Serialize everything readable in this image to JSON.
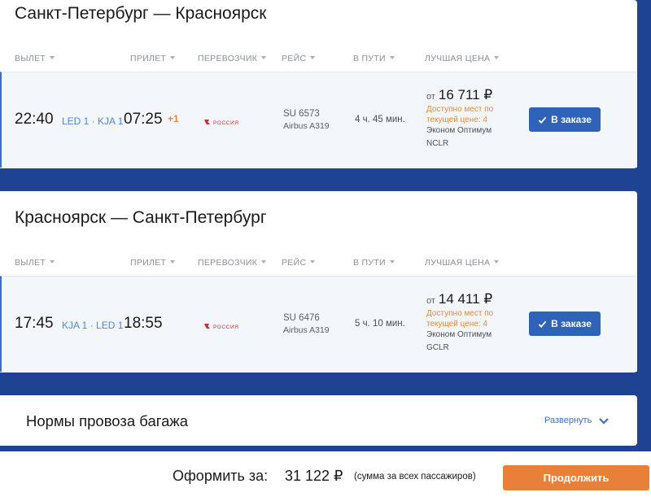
{
  "columns": {
    "depart": "ВЫЛЕТ",
    "arrive": "ПРИЛЕТ",
    "carrier": "ПЕРЕВОЗЧИК",
    "flight": "РЕЙС",
    "duration": "В ПУТИ",
    "best_price": "ЛУЧШАЯ ЦЕНА"
  },
  "segments": [
    {
      "route": "Санкт-Петербург — Красноярск",
      "depart_time": "22:40",
      "airports": "LED 1 · KJA 1",
      "arrive_time": "07:25",
      "day_offset": "+1",
      "carrier_logo_text": "РОССИЯ",
      "flight_no": "SU 6573",
      "aircraft": "Airbus A319",
      "duration": "4 ч. 45 мин.",
      "price_prefix": "от",
      "price": "16 711 ₽",
      "seats_left": "Доступно мест по текущей цене: 4",
      "fare": "Эконом Оптимум",
      "fare_code": "NCLR",
      "book_label": "В заказе"
    },
    {
      "route": "Красноярск — Санкт-Петербург",
      "depart_time": "17:45",
      "airports": "KJA 1 · LED 1",
      "arrive_time": "18:55",
      "day_offset": "",
      "carrier_logo_text": "РОССИЯ",
      "flight_no": "SU 6476",
      "aircraft": "Airbus A319",
      "duration": "5 ч. 10 мин.",
      "price_prefix": "от",
      "price": "14 411 ₽",
      "seats_left": "Доступно мест по текущей цене: 4",
      "fare": "Эконом Оптимум",
      "fare_code": "GCLR",
      "book_label": "В заказе"
    }
  ],
  "baggage": {
    "title": "Нормы провоза багажа",
    "expand_label": "Развернуть"
  },
  "footer": {
    "label": "Оформить за:",
    "total": "31 122 ₽",
    "note": "(сумма за всех пассажиров)",
    "continue_label": "Продолжить"
  },
  "colors": {
    "background": "#1e4392",
    "link": "#4f86d6",
    "accent_orange": "#e88a2e",
    "button_blue": "#2f63b8",
    "carrier_red": "#d42a2a"
  }
}
